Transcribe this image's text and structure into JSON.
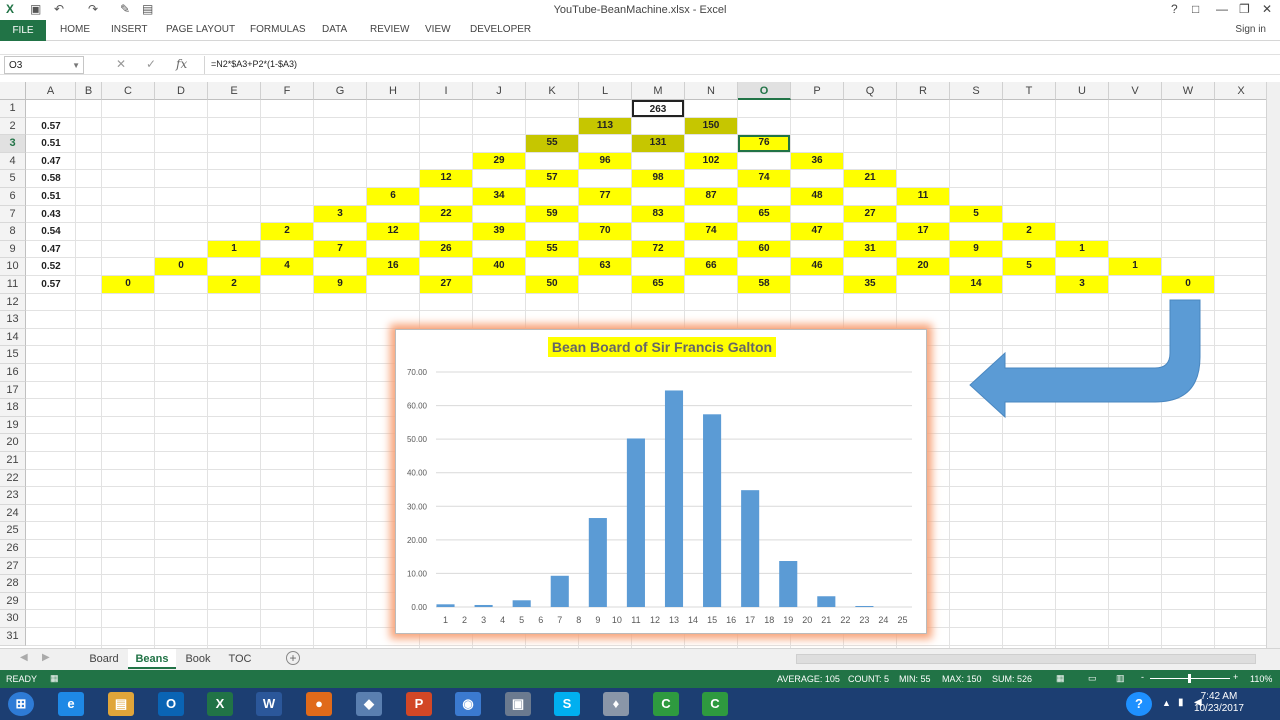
{
  "window": {
    "title": "YouTube-BeanMachine.xlsx - Excel",
    "help": "?",
    "restore": "□",
    "minimize": "—",
    "maximize": "❐",
    "close": "✕"
  },
  "ribbon": {
    "file_tab": "FILE",
    "tabs": [
      "HOME",
      "INSERT",
      "PAGE LAYOUT",
      "FORMULAS",
      "DATA",
      "REVIEW",
      "VIEW",
      "DEVELOPER"
    ],
    "sign_in": "Sign in"
  },
  "formula_bar": {
    "name_box": "O3",
    "formula": "=N2*$A3+P2*(1-$A3)"
  },
  "columns": [
    "A",
    "B",
    "C",
    "D",
    "E",
    "F",
    "G",
    "H",
    "I",
    "J",
    "K",
    "L",
    "M",
    "N",
    "O",
    "P",
    "Q",
    "R",
    "S",
    "T",
    "U",
    "V",
    "W",
    "X"
  ],
  "selected_column": "O",
  "selected_row": 3,
  "rows": [
    "1",
    "2",
    "3",
    "4",
    "5",
    "6",
    "7",
    "8",
    "9",
    "10",
    "11",
    "12",
    "13",
    "14",
    "15",
    "16",
    "17",
    "18",
    "19",
    "20",
    "21",
    "22",
    "23",
    "24",
    "25",
    "26",
    "27",
    "28",
    "29",
    "30",
    "31"
  ],
  "probabilities": [
    {
      "row": 2,
      "value": "0.57"
    },
    {
      "row": 3,
      "value": "0.51"
    },
    {
      "row": 4,
      "value": "0.47"
    },
    {
      "row": 5,
      "value": "0.58"
    },
    {
      "row": 6,
      "value": "0.51"
    },
    {
      "row": 7,
      "value": "0.43"
    },
    {
      "row": 8,
      "value": "0.54"
    },
    {
      "row": 9,
      "value": "0.47"
    },
    {
      "row": 10,
      "value": "0.52"
    },
    {
      "row": 11,
      "value": "0.57"
    }
  ],
  "cells": [
    {
      "col": "M",
      "row": 1,
      "value": "263",
      "style": "boxed"
    },
    {
      "col": "L",
      "row": 2,
      "value": "113",
      "style": "o"
    },
    {
      "col": "N",
      "row": 2,
      "value": "150",
      "style": "o"
    },
    {
      "col": "K",
      "row": 3,
      "value": "55",
      "style": "o"
    },
    {
      "col": "M",
      "row": 3,
      "value": "131",
      "style": "o"
    },
    {
      "col": "O",
      "row": 3,
      "value": "76",
      "style": "y"
    },
    {
      "col": "J",
      "row": 4,
      "value": "29",
      "style": "y"
    },
    {
      "col": "L",
      "row": 4,
      "value": "96",
      "style": "y"
    },
    {
      "col": "N",
      "row": 4,
      "value": "102",
      "style": "y"
    },
    {
      "col": "P",
      "row": 4,
      "value": "36",
      "style": "y"
    },
    {
      "col": "I",
      "row": 5,
      "value": "12",
      "style": "y"
    },
    {
      "col": "K",
      "row": 5,
      "value": "57",
      "style": "y"
    },
    {
      "col": "M",
      "row": 5,
      "value": "98",
      "style": "y"
    },
    {
      "col": "O",
      "row": 5,
      "value": "74",
      "style": "y"
    },
    {
      "col": "Q",
      "row": 5,
      "value": "21",
      "style": "y"
    },
    {
      "col": "H",
      "row": 6,
      "value": "6",
      "style": "y"
    },
    {
      "col": "J",
      "row": 6,
      "value": "34",
      "style": "y"
    },
    {
      "col": "L",
      "row": 6,
      "value": "77",
      "style": "y"
    },
    {
      "col": "N",
      "row": 6,
      "value": "87",
      "style": "y"
    },
    {
      "col": "P",
      "row": 6,
      "value": "48",
      "style": "y"
    },
    {
      "col": "R",
      "row": 6,
      "value": "11",
      "style": "y"
    },
    {
      "col": "G",
      "row": 7,
      "value": "3",
      "style": "y"
    },
    {
      "col": "I",
      "row": 7,
      "value": "22",
      "style": "y"
    },
    {
      "col": "K",
      "row": 7,
      "value": "59",
      "style": "y"
    },
    {
      "col": "M",
      "row": 7,
      "value": "83",
      "style": "y"
    },
    {
      "col": "O",
      "row": 7,
      "value": "65",
      "style": "y"
    },
    {
      "col": "Q",
      "row": 7,
      "value": "27",
      "style": "y"
    },
    {
      "col": "S",
      "row": 7,
      "value": "5",
      "style": "y"
    },
    {
      "col": "F",
      "row": 8,
      "value": "2",
      "style": "y"
    },
    {
      "col": "H",
      "row": 8,
      "value": "12",
      "style": "y"
    },
    {
      "col": "J",
      "row": 8,
      "value": "39",
      "style": "y"
    },
    {
      "col": "L",
      "row": 8,
      "value": "70",
      "style": "y"
    },
    {
      "col": "N",
      "row": 8,
      "value": "74",
      "style": "y"
    },
    {
      "col": "P",
      "row": 8,
      "value": "47",
      "style": "y"
    },
    {
      "col": "R",
      "row": 8,
      "value": "17",
      "style": "y"
    },
    {
      "col": "T",
      "row": 8,
      "value": "2",
      "style": "y"
    },
    {
      "col": "E",
      "row": 9,
      "value": "1",
      "style": "y"
    },
    {
      "col": "G",
      "row": 9,
      "value": "7",
      "style": "y"
    },
    {
      "col": "I",
      "row": 9,
      "value": "26",
      "style": "y"
    },
    {
      "col": "K",
      "row": 9,
      "value": "55",
      "style": "y"
    },
    {
      "col": "M",
      "row": 9,
      "value": "72",
      "style": "y"
    },
    {
      "col": "O",
      "row": 9,
      "value": "60",
      "style": "y"
    },
    {
      "col": "Q",
      "row": 9,
      "value": "31",
      "style": "y"
    },
    {
      "col": "S",
      "row": 9,
      "value": "9",
      "style": "y"
    },
    {
      "col": "U",
      "row": 9,
      "value": "1",
      "style": "y"
    },
    {
      "col": "D",
      "row": 10,
      "value": "0",
      "style": "y"
    },
    {
      "col": "F",
      "row": 10,
      "value": "4",
      "style": "y"
    },
    {
      "col": "H",
      "row": 10,
      "value": "16",
      "style": "y"
    },
    {
      "col": "J",
      "row": 10,
      "value": "40",
      "style": "y"
    },
    {
      "col": "L",
      "row": 10,
      "value": "63",
      "style": "y"
    },
    {
      "col": "N",
      "row": 10,
      "value": "66",
      "style": "y"
    },
    {
      "col": "P",
      "row": 10,
      "value": "46",
      "style": "y"
    },
    {
      "col": "R",
      "row": 10,
      "value": "20",
      "style": "y"
    },
    {
      "col": "T",
      "row": 10,
      "value": "5",
      "style": "y"
    },
    {
      "col": "V",
      "row": 10,
      "value": "1",
      "style": "y"
    },
    {
      "col": "C",
      "row": 11,
      "value": "0",
      "style": "y"
    },
    {
      "col": "E",
      "row": 11,
      "value": "2",
      "style": "y"
    },
    {
      "col": "G",
      "row": 11,
      "value": "9",
      "style": "y"
    },
    {
      "col": "I",
      "row": 11,
      "value": "27",
      "style": "y"
    },
    {
      "col": "K",
      "row": 11,
      "value": "50",
      "style": "y"
    },
    {
      "col": "M",
      "row": 11,
      "value": "65",
      "style": "y"
    },
    {
      "col": "O",
      "row": 11,
      "value": "58",
      "style": "y"
    },
    {
      "col": "Q",
      "row": 11,
      "value": "35",
      "style": "y"
    },
    {
      "col": "S",
      "row": 11,
      "value": "14",
      "style": "y"
    },
    {
      "col": "U",
      "row": 11,
      "value": "3",
      "style": "y"
    },
    {
      "col": "W",
      "row": 11,
      "value": "0",
      "style": "y"
    }
  ],
  "chart_data": {
    "type": "bar",
    "title": "Bean Board of Sir Francis Galton",
    "categories": [
      "1",
      "2",
      "3",
      "4",
      "5",
      "6",
      "7",
      "8",
      "9",
      "10",
      "11",
      "12",
      "13",
      "14",
      "15",
      "16",
      "17",
      "18",
      "19",
      "20",
      "21",
      "22",
      "23",
      "24",
      "25"
    ],
    "values": [
      0.8,
      0,
      0.6,
      0,
      2,
      0,
      9.3,
      0,
      26.5,
      0,
      50.2,
      0,
      64.5,
      0,
      57.4,
      0,
      34.8,
      0,
      13.7,
      0,
      3.2,
      0,
      0.3,
      0,
      0
    ],
    "ylim": [
      0,
      70
    ],
    "yticks": [
      "0.00",
      "10.00",
      "20.00",
      "30.00",
      "40.00",
      "50.00",
      "60.00",
      "70.00"
    ],
    "grid": true,
    "bar_color": "#5b9bd5",
    "title_highlight": "#ffff00"
  },
  "arrow": {
    "color": "#5b9bd5",
    "icon": "bent-arrow-left-icon"
  },
  "sheet_tabs": [
    "Board",
    "Beans",
    "Book",
    "TOC"
  ],
  "active_sheet": "Beans",
  "add_sheet": "+",
  "status": {
    "ready": "READY",
    "average": "AVERAGE: 105",
    "count": "COUNT: 5",
    "min": "MIN: 55",
    "max": "MAX: 150",
    "sum": "SUM: 526",
    "zoom": "110%",
    "zoom_minus": "-",
    "zoom_plus": "+"
  },
  "taskbar": {
    "time": "7:42 AM",
    "date": "10/23/2017",
    "icons": [
      "start-icon",
      "ie-icon",
      "explorer-icon",
      "outlook-icon",
      "excel-icon",
      "word-icon",
      "app-icon",
      "powerpoint-icon",
      "chrome-icon",
      "app2-icon",
      "skype-icon",
      "app3-icon",
      "camtasia-icon",
      "camtasia2-icon"
    ]
  },
  "colors": {
    "excel_green": "#217346",
    "highlight_yellow": "#ffff00",
    "olive": "#c6c600"
  }
}
